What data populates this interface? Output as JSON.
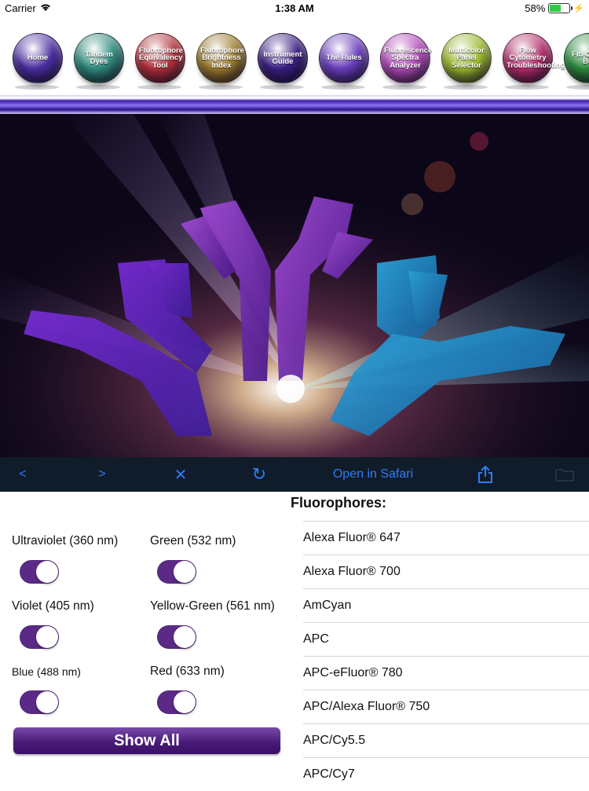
{
  "status_bar": {
    "carrier": "Carrier",
    "time": "1:38 AM",
    "battery_percent": "58%",
    "battery_level": 0.58
  },
  "nav_orbs": [
    {
      "label": "Home",
      "color": "#4a2ea0"
    },
    {
      "label": "Tandem Dyes",
      "color": "#2e8b7c"
    },
    {
      "label": "Fluorophore Equivalency Tool",
      "color": "#b3303a"
    },
    {
      "label": "Fluorophore Brightness Index",
      "color": "#9c7a2c"
    },
    {
      "label": "Instrument Guide",
      "color": "#3a1f82"
    },
    {
      "label": "The Rules",
      "color": "#6a3fbd"
    },
    {
      "label": "Fluorescence Spectra Analyzer",
      "color": "#b04bb8"
    },
    {
      "label": "Multicolor Panel Selector",
      "color": "#9ab82c"
    },
    {
      "label": "Flow Cytometry Troubleshooting",
      "color": "#b42c6a"
    },
    {
      "label": "Flo Cyton Buf",
      "color": "#2a8c3c"
    }
  ],
  "browser_toolbar": {
    "back": "<",
    "forward": ">",
    "close": "✕",
    "reload": "↻",
    "open_in_safari": "Open in Safari",
    "share": "share-icon",
    "bookmarks": "folder-icon"
  },
  "lasers": [
    {
      "label": "Ultraviolet (360 nm)",
      "enabled": true
    },
    {
      "label": "Green (532 nm)",
      "enabled": true
    },
    {
      "label": "Violet (405 nm)",
      "enabled": true
    },
    {
      "label": "Yellow-Green (561 nm)",
      "enabled": true
    },
    {
      "label": "Blue (488 nm)",
      "enabled": true
    },
    {
      "label": "Red (633 nm)",
      "enabled": true
    }
  ],
  "show_all_label": "Show All",
  "fluorophores": {
    "heading": "Fluorophores:",
    "items": [
      "Alexa Fluor® 647",
      "Alexa Fluor® 700",
      "AmCyan",
      "APC",
      "APC-eFluor® 780",
      "APC/Alexa Fluor® 750",
      "APC/Cy5.5",
      "APC/Cy7"
    ]
  },
  "accent_color": "#5b2a86",
  "link_color": "#2f7cf6"
}
